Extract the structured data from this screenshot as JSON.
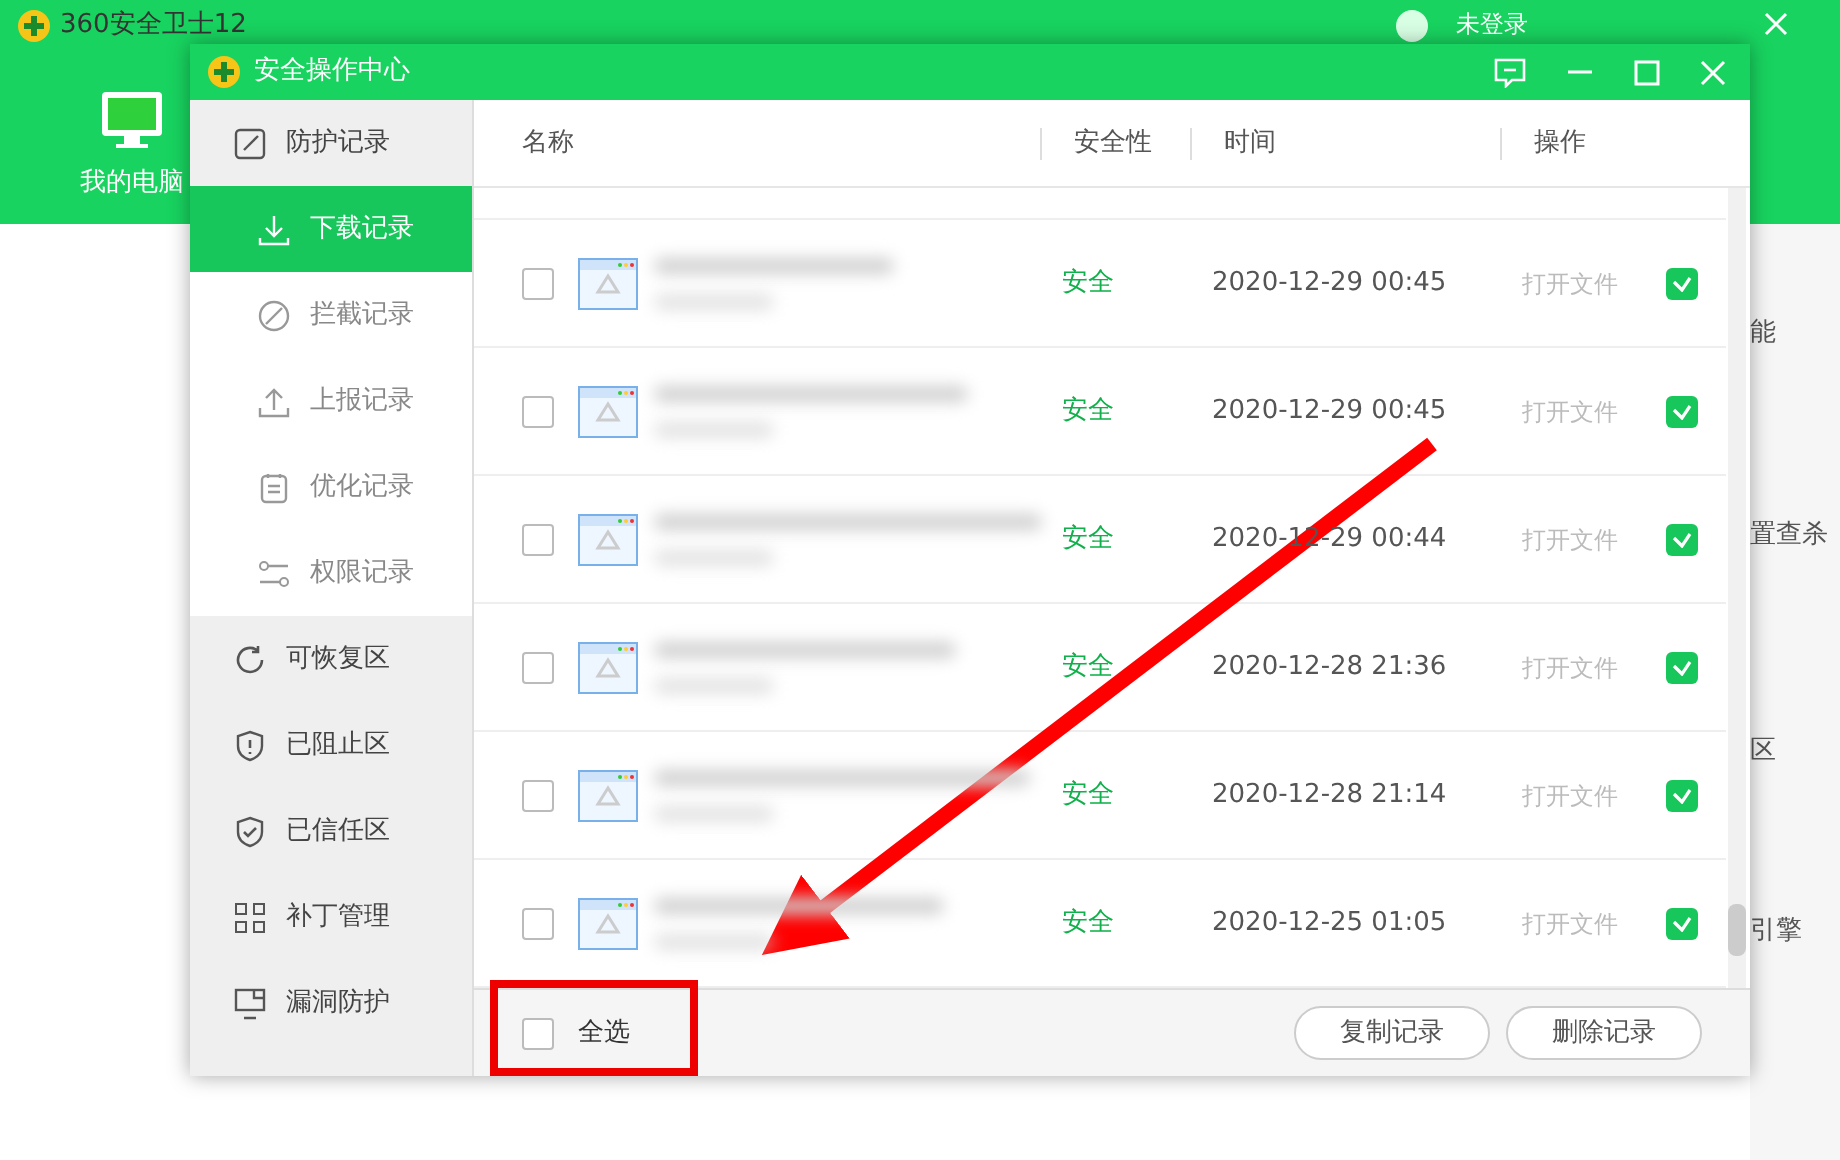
{
  "app": {
    "title": "360安全卫士12",
    "user": "未登录",
    "nav": [
      {
        "label": "我的电脑"
      }
    ],
    "side_texts": [
      "能",
      "置查杀",
      "区",
      "引擎"
    ]
  },
  "dialog": {
    "title": "安全操作中心",
    "sidebar": {
      "items": [
        {
          "label": "防护记录",
          "selected": false,
          "children": [
            {
              "label": "下载记录",
              "selected": true
            },
            {
              "label": "拦截记录",
              "selected": false
            },
            {
              "label": "上报记录",
              "selected": false
            },
            {
              "label": "优化记录",
              "selected": false
            },
            {
              "label": "权限记录",
              "selected": false
            }
          ]
        },
        {
          "label": "可恢复区",
          "selected": false
        },
        {
          "label": "已阻止区",
          "selected": false
        },
        {
          "label": "已信任区",
          "selected": false
        },
        {
          "label": "补丁管理",
          "selected": false
        },
        {
          "label": "漏洞防护",
          "selected": false
        }
      ]
    },
    "table": {
      "columns": [
        "名称",
        "安全性",
        "时间",
        "操作"
      ],
      "rows": [
        {
          "selected": false,
          "safety": "安全",
          "time": "2020-12-29 00:45",
          "action": "打开文件",
          "checked": true
        },
        {
          "selected": false,
          "safety": "安全",
          "time": "2020-12-29 00:45",
          "action": "打开文件",
          "checked": true
        },
        {
          "selected": false,
          "safety": "安全",
          "time": "2020-12-29 00:44",
          "action": "打开文件",
          "checked": true
        },
        {
          "selected": false,
          "safety": "安全",
          "time": "2020-12-28 21:36",
          "action": "打开文件",
          "checked": true
        },
        {
          "selected": false,
          "safety": "安全",
          "time": "2020-12-28 21:14",
          "action": "打开文件",
          "checked": true
        },
        {
          "selected": false,
          "safety": "安全",
          "time": "2020-12-25 01:05",
          "action": "打开文件",
          "checked": true
        }
      ]
    },
    "footer": {
      "select_all": {
        "label": "全选",
        "checked": false
      },
      "buttons": [
        "复制记录",
        "删除记录"
      ]
    }
  }
}
